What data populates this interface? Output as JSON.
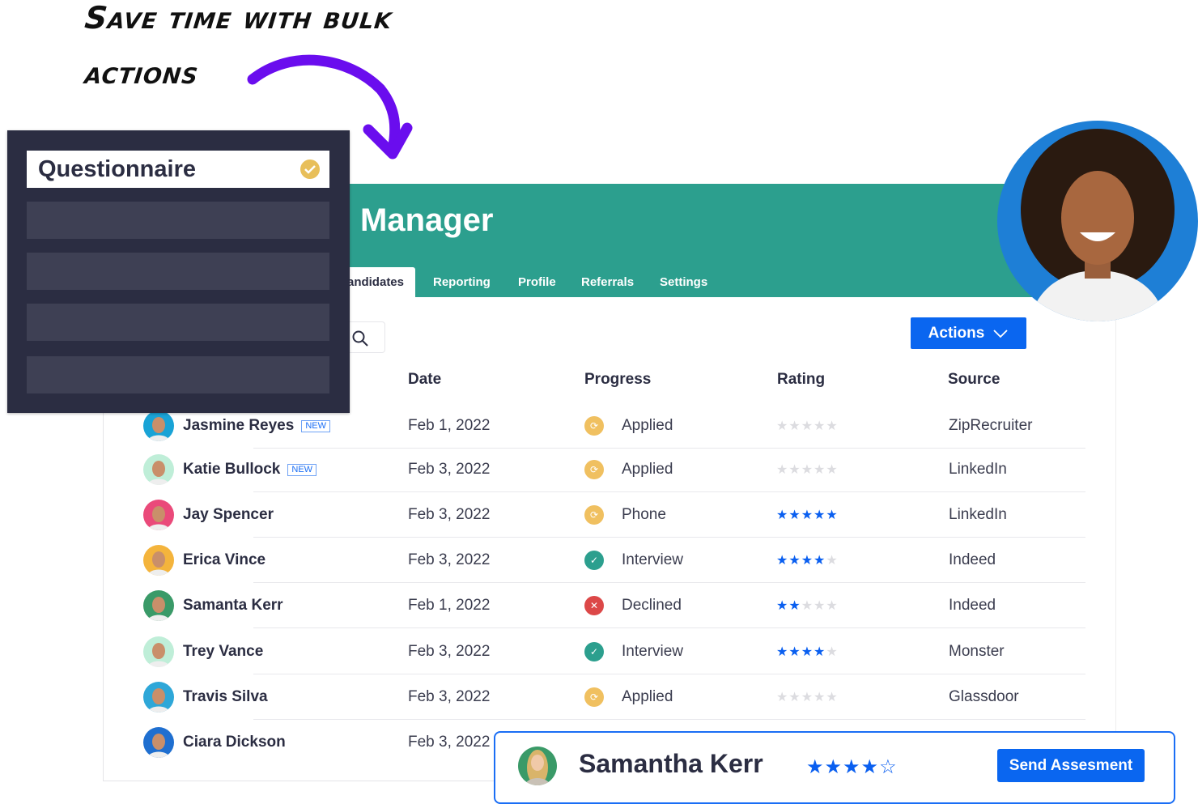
{
  "headline": {
    "line1": "Save time with bulk",
    "line2": "actions"
  },
  "colors": {
    "accent": "#2c9f8e",
    "primary": "#0a66f0",
    "arrow": "#6a0dee",
    "panel": "#2b2d42"
  },
  "panel": {
    "selected_label": "Questionnaire",
    "selected_icon": "check-circle-icon"
  },
  "app": {
    "title": "Manager"
  },
  "tabs": [
    {
      "label": "Candidates",
      "active": true
    },
    {
      "label": "Reporting"
    },
    {
      "label": "Profile"
    },
    {
      "label": "Referrals"
    },
    {
      "label": "Settings"
    }
  ],
  "toolbar": {
    "actions_label": "Actions"
  },
  "table": {
    "headers": {
      "date": "Date",
      "progress": "Progress",
      "rating": "Rating",
      "source": "Source"
    },
    "rows": [
      {
        "name": "Jasmine Reyes",
        "badge": "NEW",
        "date": "Feb 1, 2022",
        "progress": "Applied",
        "status": "pending",
        "rating": 0,
        "source": "ZipRecruiter",
        "avatar": "#19a3d6"
      },
      {
        "name": "Katie Bullock",
        "badge": "NEW",
        "date": "Feb 3, 2022",
        "progress": "Applied",
        "status": "pending",
        "rating": 0,
        "source": "LinkedIn",
        "avatar": "#bfeed8"
      },
      {
        "name": "Jay Spencer",
        "date": "Feb 3, 2022",
        "progress": "Phone",
        "status": "pending",
        "rating": 5,
        "source": "LinkedIn",
        "avatar": "#ea4a7a"
      },
      {
        "name": "Erica Vince",
        "date": "Feb 3, 2022",
        "progress": "Interview",
        "status": "ok",
        "rating": 4,
        "source": "Indeed",
        "avatar": "#f4b43c"
      },
      {
        "name": "Samanta Kerr",
        "date": "Feb 1, 2022",
        "progress": "Declined",
        "status": "declined",
        "rating": 2,
        "source": "Indeed",
        "avatar": "#3a9a68"
      },
      {
        "name": "Trey Vance",
        "date": "Feb 3, 2022",
        "progress": "Interview",
        "status": "ok",
        "rating": 4,
        "source": "Monster",
        "avatar": "#bfeed8"
      },
      {
        "name": "Travis Silva",
        "date": "Feb 3, 2022",
        "progress": "Applied",
        "status": "pending",
        "rating": 0,
        "source": "Glassdoor",
        "avatar": "#2ea7d8"
      },
      {
        "name": "Ciara Dickson",
        "date": "Feb 3, 2022",
        "avatar": "#1f6fd0"
      }
    ]
  },
  "popup": {
    "name": "Samantha Kerr",
    "rating": 4,
    "button": "Send Assesment"
  }
}
